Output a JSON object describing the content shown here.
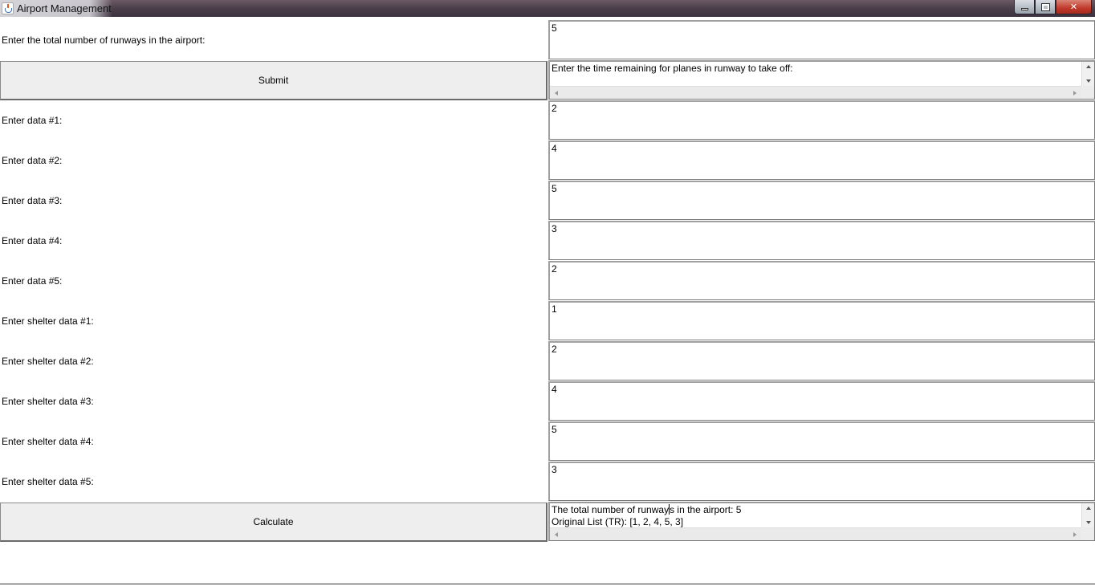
{
  "window": {
    "title": "Airport Management"
  },
  "runways": {
    "label": "Enter the total number of runways in the airport:",
    "value": "5"
  },
  "submit": {
    "label": "Submit",
    "prompt_text": "Enter the time remaining for planes in runway to take off:"
  },
  "data_rows": [
    {
      "label": "Enter data #1:",
      "value": "2"
    },
    {
      "label": "Enter data #2:",
      "value": "4"
    },
    {
      "label": "Enter data #3:",
      "value": "5"
    },
    {
      "label": "Enter data #4:",
      "value": "3"
    },
    {
      "label": "Enter data #5:",
      "value": "2"
    },
    {
      "label": "Enter shelter data #1:",
      "value": "1"
    },
    {
      "label": "Enter shelter data #2:",
      "value": "2"
    },
    {
      "label": "Enter shelter data #3:",
      "value": "4"
    },
    {
      "label": "Enter shelter data #4:",
      "value": "5"
    },
    {
      "label": "Enter shelter data #5:",
      "value": "3"
    }
  ],
  "calculate": {
    "label": "Calculate",
    "output_line1_before_caret": "The total number of runway",
    "output_line1_after_caret": "s in the airport: 5",
    "output_line2": "Original List (TR): [1, 2, 4, 5, 3]"
  }
}
